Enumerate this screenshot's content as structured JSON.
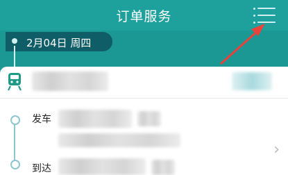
{
  "header": {
    "title": "订单服务",
    "menu_icon": "list-menu-icon"
  },
  "trip": {
    "date": "2月04日 周四",
    "depart_label": "发车",
    "arrive_label": "到达",
    "vehicle_icon": "train-icon",
    "chevron_icon": "chevron-right-icon"
  },
  "colors": {
    "accent": "#1ea09c",
    "pill": "#0f5d66",
    "annotation": "#e8433c"
  }
}
